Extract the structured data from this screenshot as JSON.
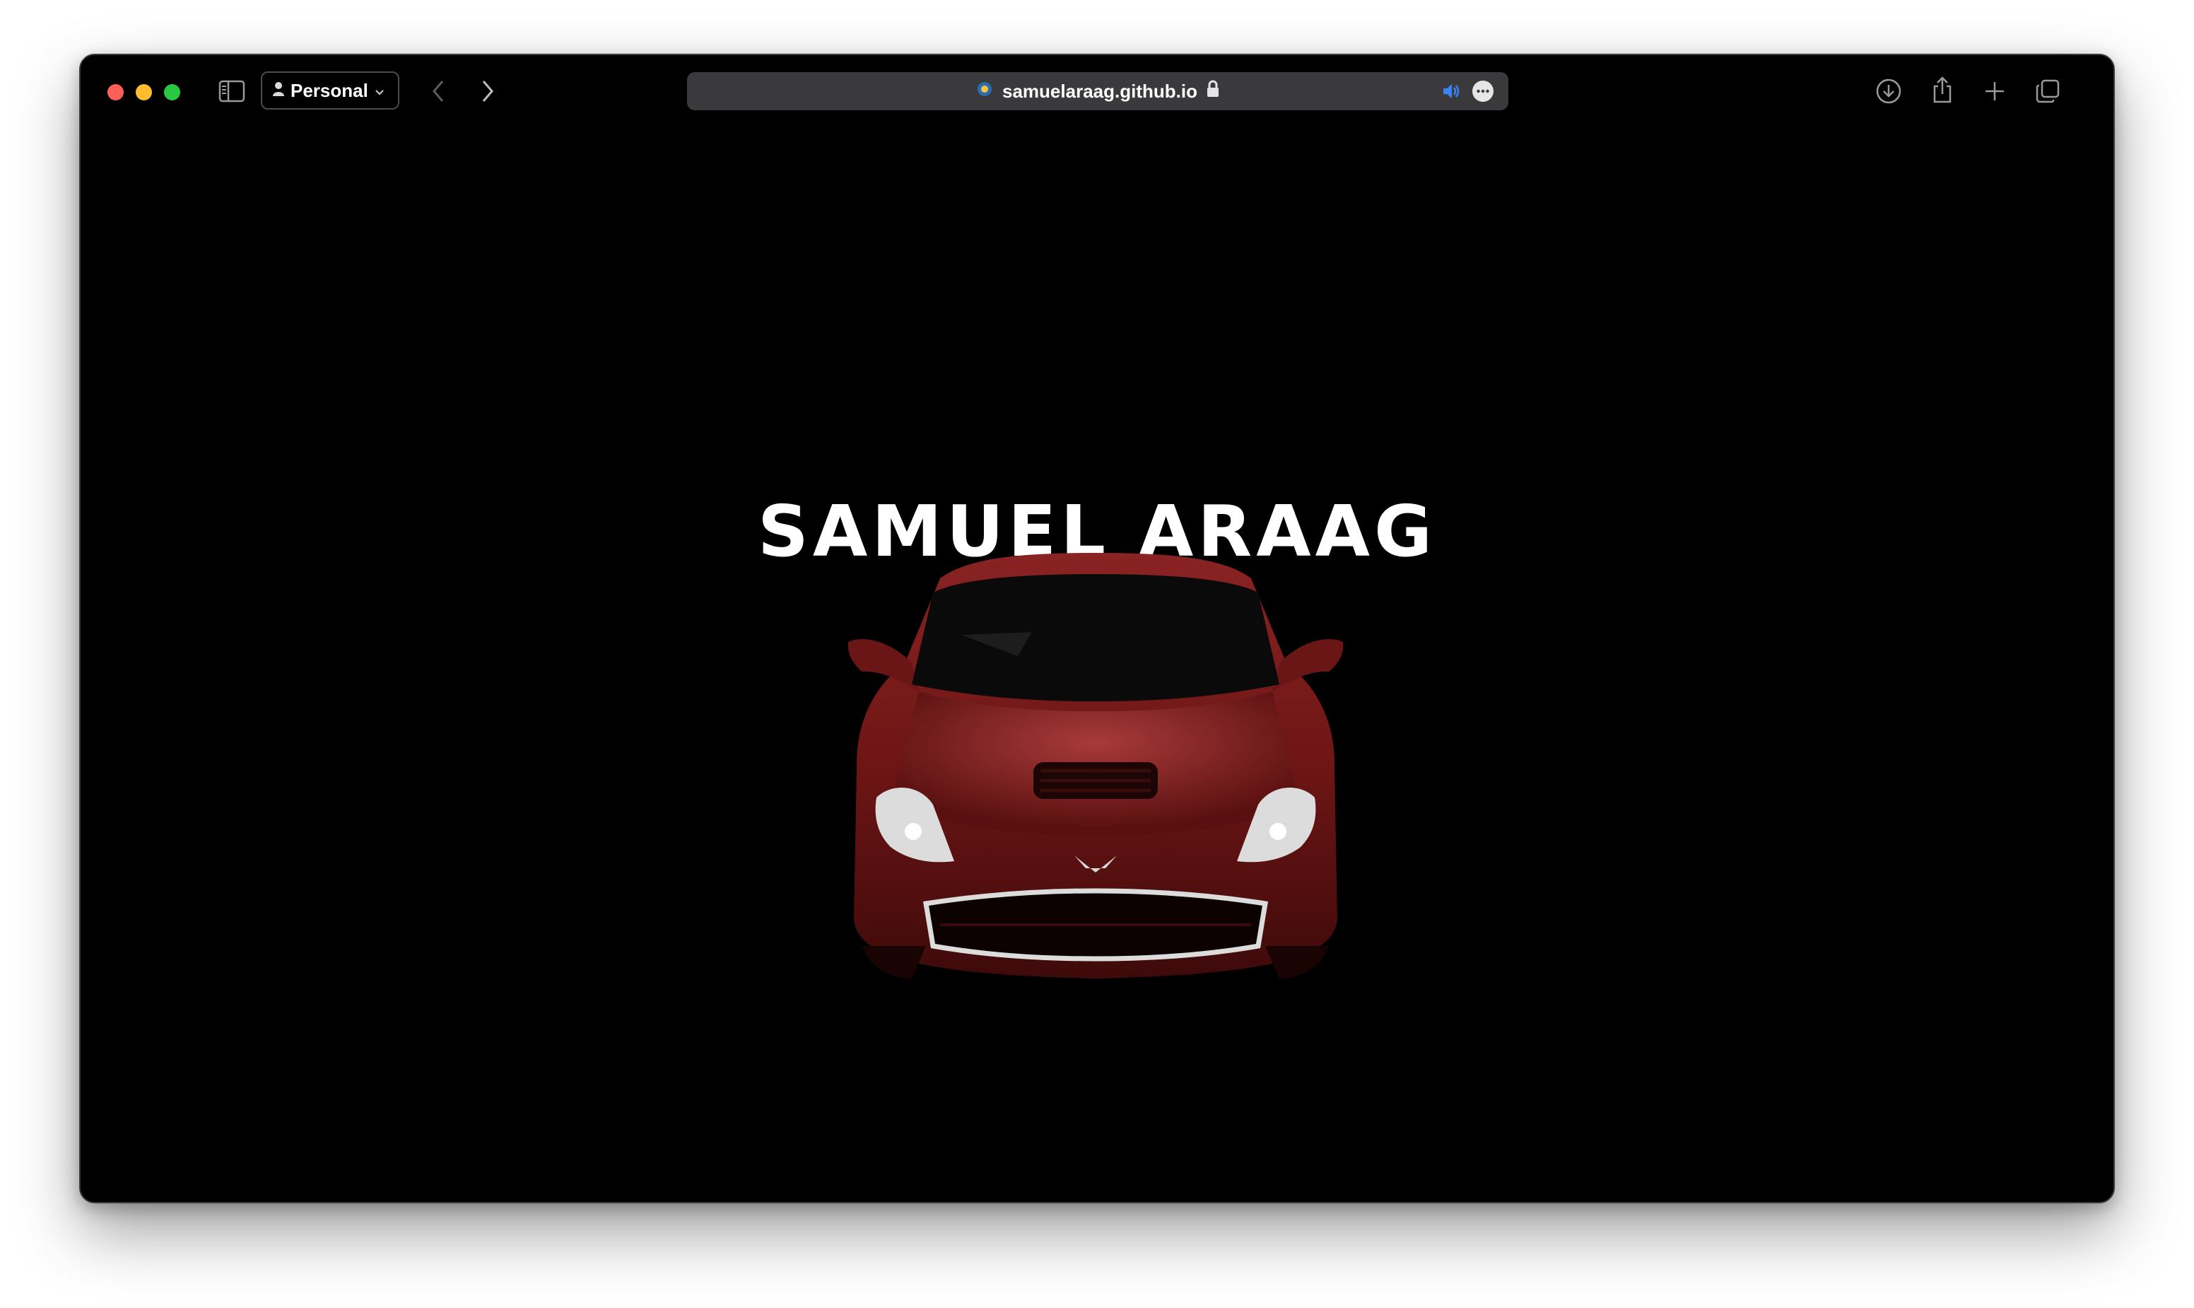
{
  "browser": {
    "profile_label": "Personal",
    "url": "samuelaraag.github.io",
    "icons": {
      "close": "close-dot",
      "minimize": "minimize-dot",
      "zoom": "zoom-dot",
      "sidebar": "sidebar-icon",
      "person": "person-icon",
      "chevron": "chevron-down-icon",
      "back": "back-arrow-icon",
      "forward": "forward-arrow-icon",
      "site": "site-favicon-icon",
      "lock": "lock-icon",
      "audio": "speaker-icon",
      "more": "more-icon",
      "download": "download-icon",
      "share": "share-icon",
      "new_tab": "plus-icon",
      "tabs": "tab-overview-icon"
    },
    "colors": {
      "close": "#ff5f57",
      "minimize": "#febc2e",
      "zoom": "#28c840",
      "address_bg": "#3a3a3c",
      "audio_accent": "#3b82f6"
    }
  },
  "page": {
    "hero_title": "SAMUEL ARAAG",
    "background": "#000000",
    "car_color": "#7a1a1a"
  }
}
